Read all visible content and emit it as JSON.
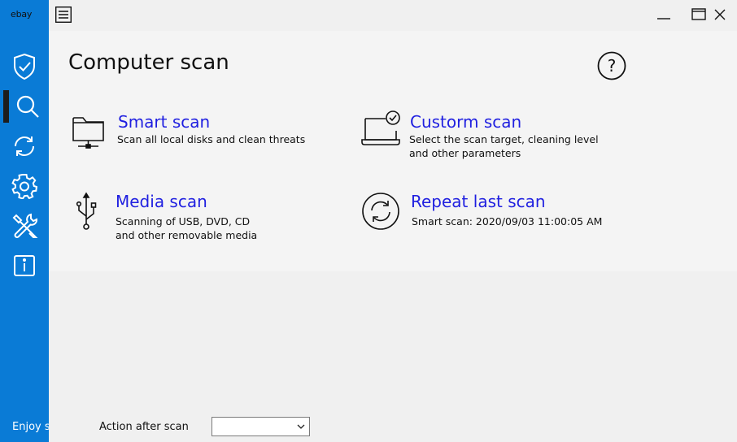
{
  "sidebar": {
    "brand": "ebay",
    "items": [
      {
        "name": "protection",
        "icon": "shield-check-icon"
      },
      {
        "name": "scan",
        "icon": "search-icon",
        "active": true
      },
      {
        "name": "update",
        "icon": "refresh-icon"
      },
      {
        "name": "settings",
        "icon": "gear-icon"
      },
      {
        "name": "tools",
        "icon": "tools-icon"
      },
      {
        "name": "info",
        "icon": "info-icon"
      }
    ],
    "footer_text": "Enjoy sa"
  },
  "page": {
    "title": "Computer scan",
    "help_symbol": "?"
  },
  "scans": {
    "smart": {
      "title": "Smart scan",
      "desc1": "Scan all local disks and clean threats",
      "icon": "folder-network-icon"
    },
    "custom": {
      "title": "Custorm scan",
      "desc1": "Select the scan target, cleaning level",
      "desc2": "and other parameters",
      "icon": "laptop-check-icon"
    },
    "media": {
      "title": "Media scan",
      "desc1": "Scanning of USB, DVD, CD",
      "desc2": "and other removable media",
      "icon": "usb-icon"
    },
    "repeat": {
      "title": "Repeat last scan",
      "desc1": "Smart scan: 2020/09/03 11:00:05 AM",
      "icon": "repeat-icon"
    }
  },
  "bottom": {
    "action_label": "Action after scan",
    "action_value": ""
  },
  "colors": {
    "sidebar": "#0a7bd6",
    "link": "#1f1fe0",
    "panel": "#f4f4f4",
    "background": "#f0f0f0"
  }
}
